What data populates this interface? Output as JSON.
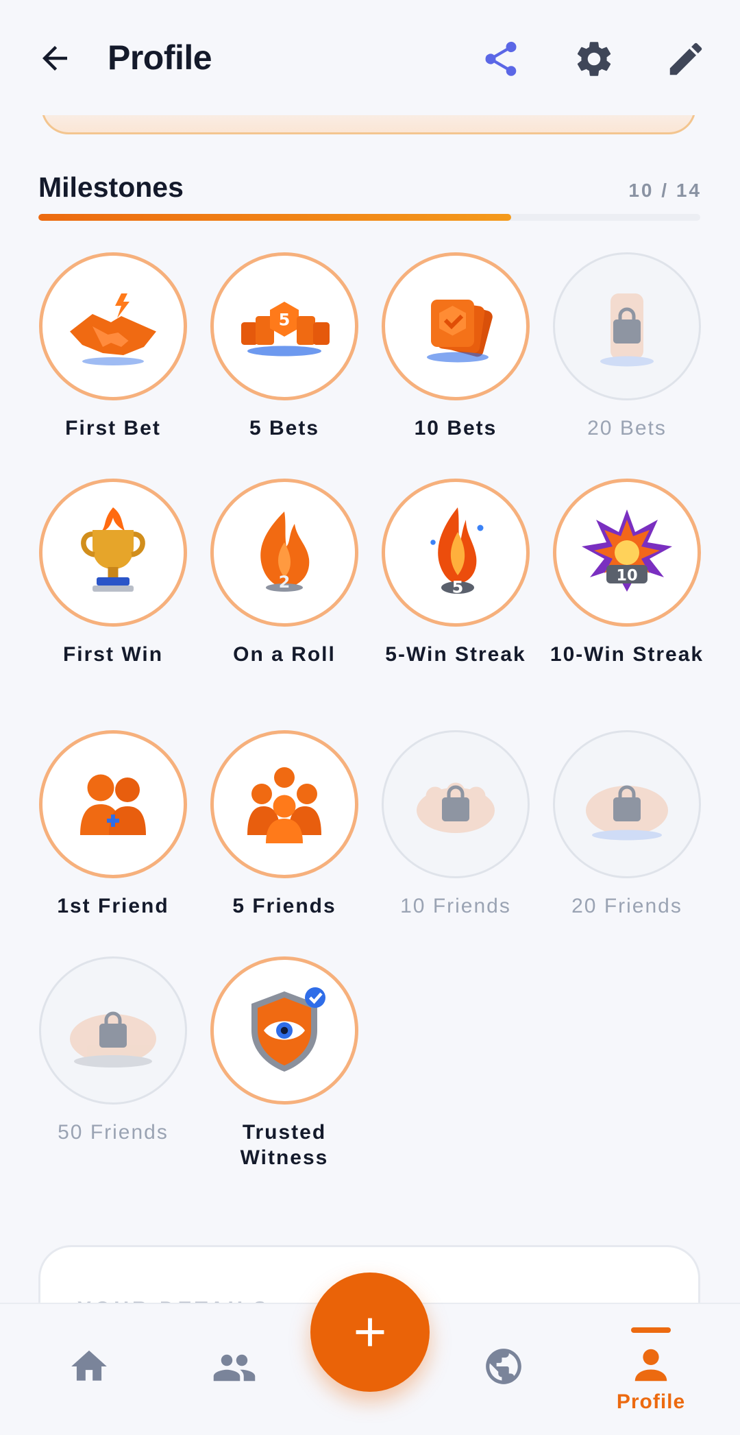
{
  "header": {
    "title": "Profile",
    "icons": {
      "back": "arrow-left-icon",
      "share": "share-icon",
      "settings": "gear-icon",
      "edit": "pencil-icon"
    }
  },
  "milestones": {
    "title": "Milestones",
    "count_text": "10 / 14",
    "unlocked": 10,
    "total": 14,
    "badges": [
      {
        "label": "First Bet",
        "icon": "handshake-icon",
        "locked": false
      },
      {
        "label": "5 Bets",
        "icon": "chip-stack-5-icon",
        "locked": false
      },
      {
        "label": "10 Bets",
        "icon": "card-stack-icon",
        "locked": false
      },
      {
        "label": "20 Bets",
        "icon": "chip-tower-icon",
        "locked": true
      },
      {
        "label": "First Win",
        "icon": "trophy-icon",
        "locked": false
      },
      {
        "label": "On a Roll",
        "icon": "flame-2-icon",
        "locked": false
      },
      {
        "label": "5-Win Streak",
        "icon": "flame-5-icon",
        "locked": false
      },
      {
        "label": "10-Win Streak",
        "icon": "explosion-10-icon",
        "locked": false
      },
      {
        "label": "1st Friend",
        "icon": "two-friends-icon",
        "locked": false
      },
      {
        "label": "5 Friends",
        "icon": "group-five-icon",
        "locked": false
      },
      {
        "label": "10 Friends",
        "icon": "group-ten-icon",
        "locked": true
      },
      {
        "label": "20 Friends",
        "icon": "group-twenty-icon",
        "locked": true
      },
      {
        "label": "50 Friends",
        "icon": "crowd-fifty-icon",
        "locked": true
      },
      {
        "label": "Trusted Witness",
        "icon": "eye-shield-icon",
        "locked": false
      }
    ]
  },
  "details": {
    "label": "YOUR DETAILS"
  },
  "nav": {
    "items": [
      {
        "key": "home",
        "icon": "home-icon"
      },
      {
        "key": "friends",
        "icon": "people-icon"
      },
      {
        "key": "add",
        "icon": "plus-icon"
      },
      {
        "key": "explore",
        "icon": "globe-icon"
      },
      {
        "key": "profile",
        "icon": "person-icon",
        "label": "Profile",
        "active": true
      }
    ]
  },
  "colors": {
    "accent": "#ec6a10",
    "badge_ring": "#f6b07c",
    "locked_text": "#9aa3b3",
    "share_icon": "#5b67e6",
    "nav_inactive": "#7a849a"
  }
}
